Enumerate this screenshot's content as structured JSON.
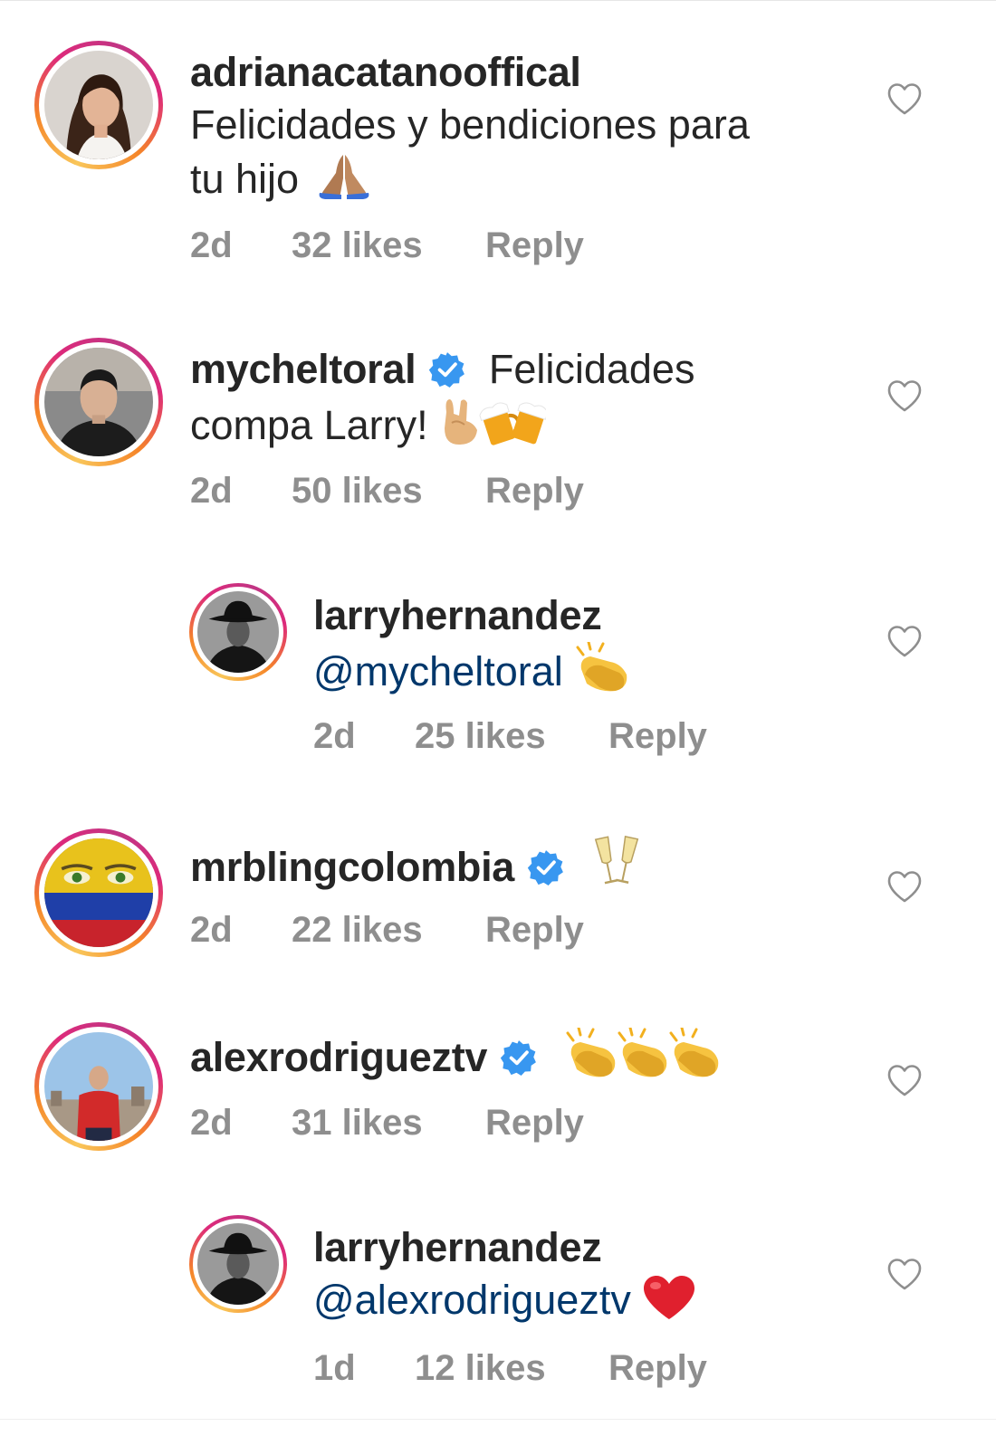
{
  "comments": [
    {
      "username": "adrianacatanooffical",
      "verified": false,
      "text_line1": "Felicidades y bendiciones para",
      "text_line2": "tu hijo",
      "emoji": "praying-hands",
      "time": "2d",
      "likes": "32 likes",
      "reply": "Reply"
    },
    {
      "username": "mycheltoral",
      "verified": true,
      "text_line1": "Felicidades",
      "text_line2": "compa Larry!",
      "emoji": "rock-hand-beer-mugs",
      "time": "2d",
      "likes": "50 likes",
      "reply": "Reply"
    },
    {
      "username": "larryhernandez",
      "verified": false,
      "mention": "@mycheltoral",
      "emoji": "clapping-hands",
      "time": "2d",
      "likes": "25 likes",
      "reply": "Reply"
    },
    {
      "username": "mrblingcolombia",
      "verified": true,
      "emoji": "champagne-glasses",
      "time": "2d",
      "likes": "22 likes",
      "reply": "Reply"
    },
    {
      "username": "alexrodrigueztv",
      "verified": true,
      "emoji": "three-clapping-hands",
      "time": "2d",
      "likes": "31 likes",
      "reply": "Reply"
    },
    {
      "username": "larryhernandez",
      "verified": false,
      "mention": "@alexrodrigueztv",
      "emoji": "red-heart",
      "time": "1d",
      "likes": "12 likes",
      "reply": "Reply"
    }
  ],
  "icons": {
    "like": "heart-outline-icon",
    "verified": "verified-badge-icon"
  },
  "colors": {
    "meta_gray": "#8e8e8e",
    "mention_blue": "#00376b",
    "verified_blue": "#3897f0",
    "story_ring_start": "#f9c65a",
    "story_ring_end": "#c13584"
  }
}
